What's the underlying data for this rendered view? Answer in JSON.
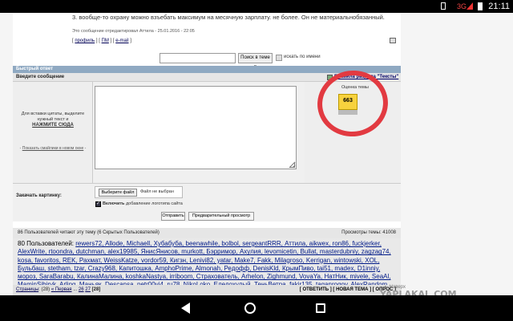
{
  "status": {
    "network": "3G",
    "time": "21:11"
  },
  "post": {
    "text": "3. вообще-то охрану можно взъебать максимум на месячную зарплату. не более. Он не материальнобязанный.",
    "edit_note": "Это сообщение отредактировал Аттила - 25.01.2016 - 22:05",
    "links": {
      "open": "[ ",
      "profile": "профиль",
      "sep1": " ] [ ",
      "pm": "ПМ",
      "sep2": " ] [ ",
      "email": "e-mail",
      "close": " ]"
    }
  },
  "search": {
    "value": "",
    "button": "Поиск в теме »",
    "checkbox_label": "искать по имени"
  },
  "quick_reply": {
    "header": "Быстрый ответ",
    "message_label": "Введите сообщение",
    "rules_link": "Правила раздела \"Тексты\"",
    "quote_hint": "Для вставки цитаты, выделите нужный текст и",
    "quote_action": "НАЖМИТЕ СЮДА",
    "smiles": "Показать смайлики в новом окне",
    "smiles_pre": "- ",
    "smiles_post": " -",
    "textarea_value": "",
    "rating_label": "Оценка темы",
    "rating_value": "663"
  },
  "upload": {
    "label": "Закачать картинку:",
    "choose_button": "Выберите файл",
    "file_status": "Файл не выбран",
    "logo_check": "✓",
    "logo_strong": "Включить",
    "logo_rest": " добавление логотипа сайта"
  },
  "buttons": {
    "send": "Отправить",
    "preview": "Предварительный просмотр"
  },
  "readers": {
    "title": "86 Пользователей читают эту тему (6 Скрытых Пользователей)",
    "views": "Просмотры темы: 41008",
    "count": "80 Пользователей: ",
    "users": "rewers72, Allode, Michaell, Хубабуба, beenawhile, bolbol, sergeantRRR, Аттила, aikwex, ron86, fuckjerker, AlexWrite, rtoondra, dutchman, alex19985, ЯнисЯнисов, murkott, Бэрримор, Ахулия, levomicetin, Bullat, masterdubniy, zagzag74, kosa, favoritos, REK, Рахмат, WeissKatze, vordor59, Кигзн, Lenivi82, yatar, Make7, Fakk, Milagroso, Kerrigan, wintowski, XOL, Бульбаш, stetham, tzar, Crazy968, Капитошка, AmphoPrime, Almonah, Редофф, DenisKld, КрымПиво, tai51, madex, D1inniy, мороз, SaraBarabu, КалинаМалина, koshkaNastya, irriboom, Страхователь, Arhelon, Zighmund, VovaYa, НатНик, mivele, SeaAl, MaminSibiryk, Arling, Маньяк, Descansa, petr00vi4, ru78, NikoLoko, Еледохулый, ТеньВетра, fakir135, taganrogov, AlexRandom, vulcano, pisuxan, Нуиладно, Frids, AlienUzbek"
  },
  "pager": {
    "pages_label": "Страницы",
    "pages_info": ": (28) ",
    "first": "« Первая",
    "ellipsis": " ... ",
    "p26": "26",
    "p27": "27",
    "current": "[28]"
  },
  "actions": "[ ОТВЕТИТЬ ] [ НОВАЯ ТЕМА ] [ ОПРОС ]",
  "scroll_hint": "▲ Наверх",
  "watermark": "YAPLAKAL.COM"
}
